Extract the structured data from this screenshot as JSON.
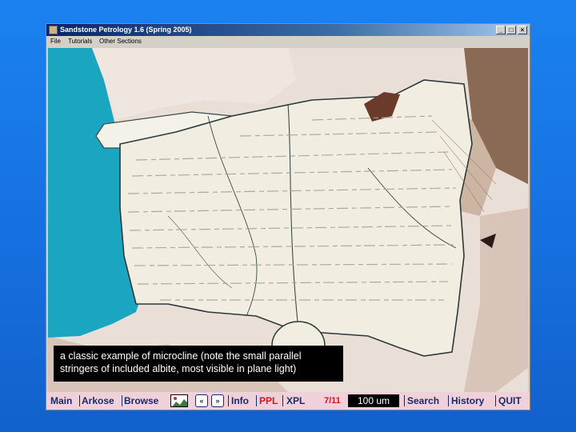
{
  "window": {
    "title": "Sandstone Petrology 1.6 (Spring 2005)",
    "min_glyph": "_",
    "max_glyph": "□",
    "close_glyph": "×"
  },
  "menu": {
    "file": "File",
    "tutorials": "Tutorials",
    "other": "Other Sections"
  },
  "caption": {
    "line1": "a classic example of microcline (note the small parallel",
    "line2": "stringers of included albite, most visible in plane light)"
  },
  "toolbar": {
    "main": "Main",
    "arkose": "Arkose",
    "browse": "Browse",
    "prev_glyph": "«",
    "next_glyph": "»",
    "info": "Info",
    "ppl": "PPL",
    "xpl": "XPL",
    "count": "7/11",
    "scale": "100 um",
    "search": "Search",
    "history": "History",
    "quit": "QUIT"
  },
  "colors": {
    "background": "#1670df",
    "titlebar": "#0a246a",
    "toolbar": "#f0d0da",
    "accent_red": "#e0101a",
    "pore_blue": "#1aa6c0",
    "crystal": "#f1eee1"
  },
  "icons": {
    "thumbnail": "image-thumbnail-icon",
    "prev": "double-chevron-left-icon",
    "next": "double-chevron-right-icon"
  }
}
